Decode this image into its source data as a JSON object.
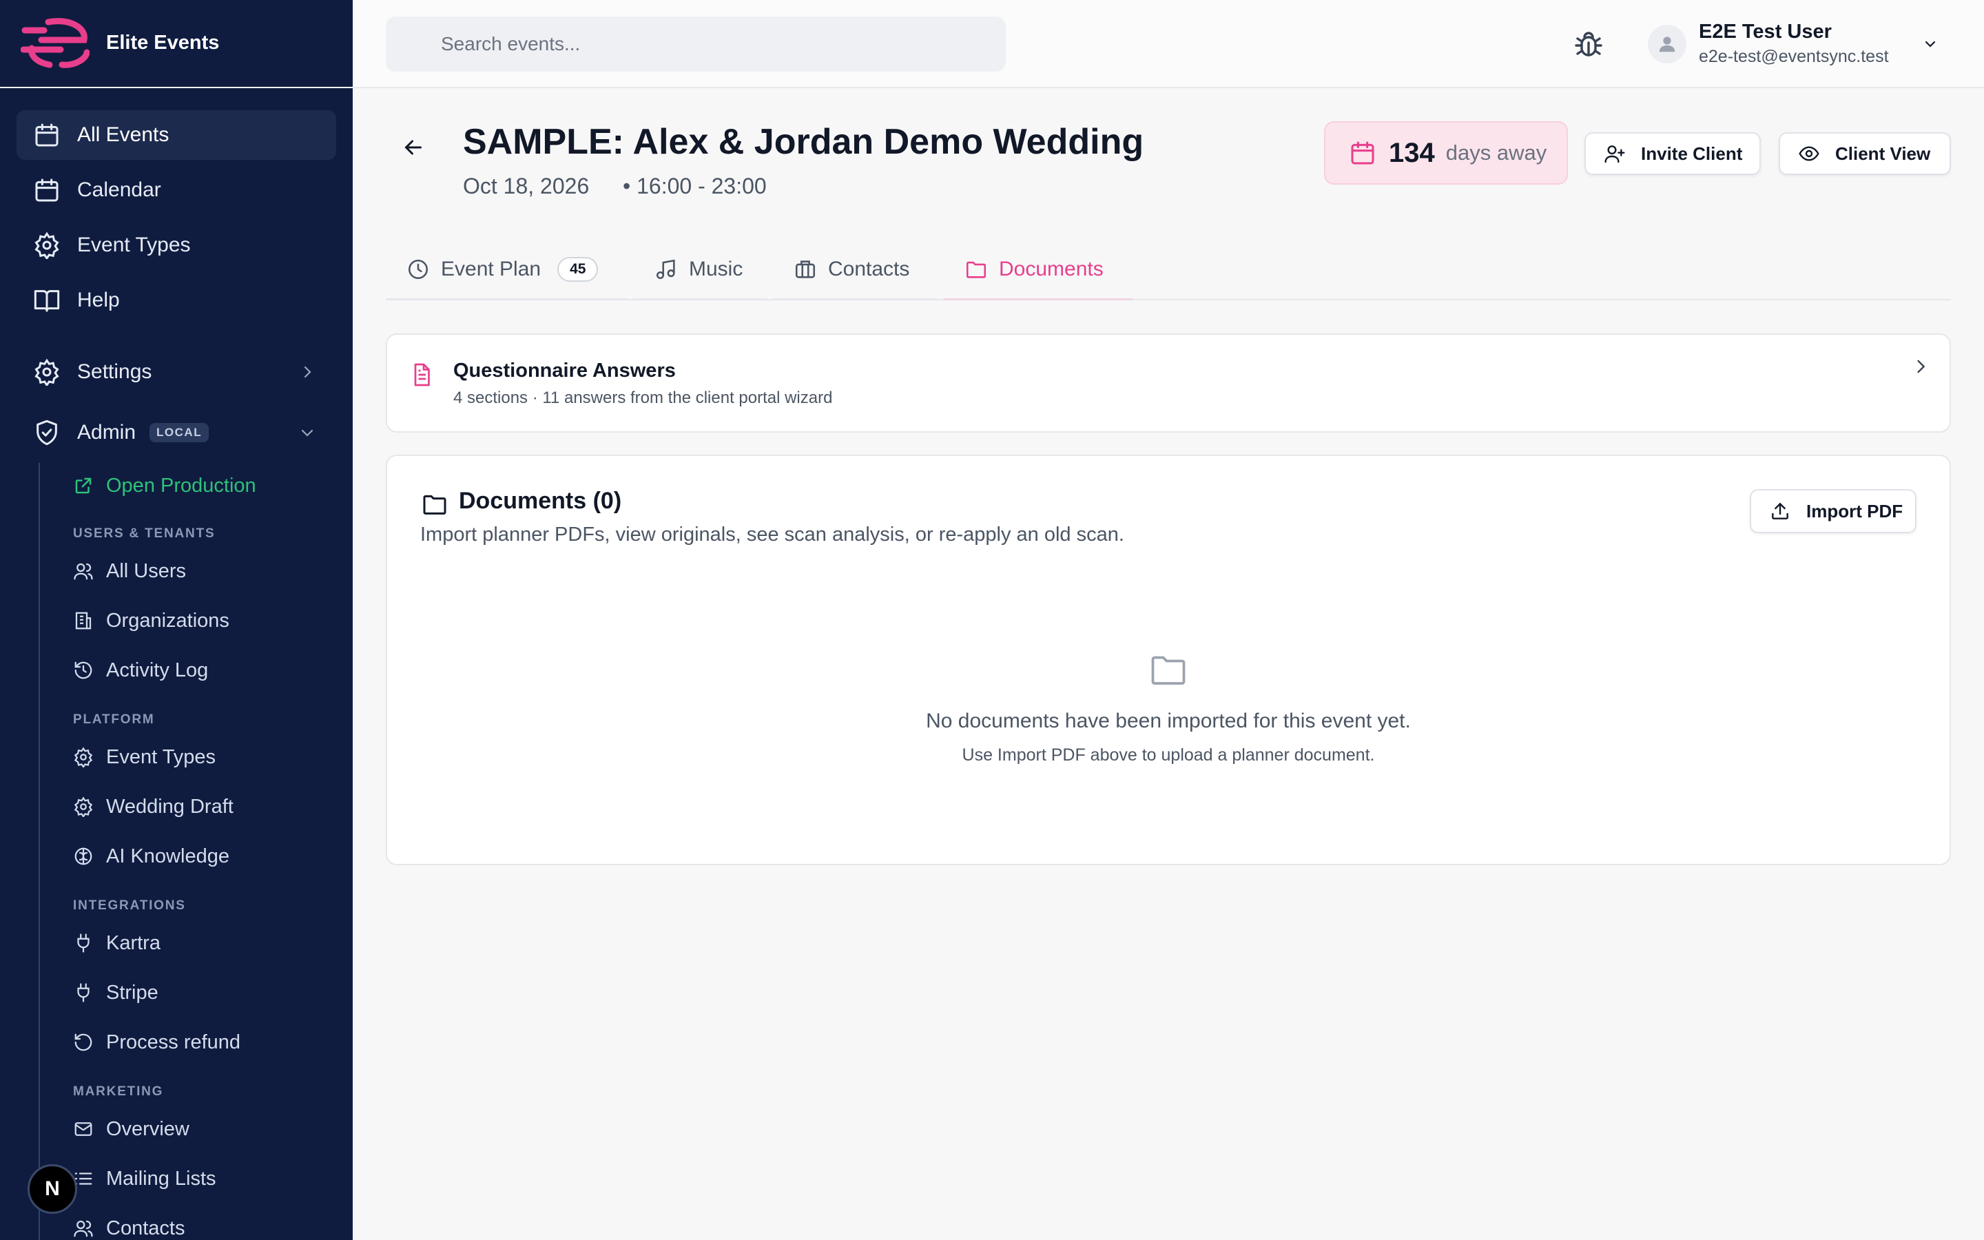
{
  "brand": {
    "name": "Elite Events",
    "accent": "#e83e8c"
  },
  "sidebar": {
    "items": [
      {
        "label": "All Events",
        "icon": "calendar-icon",
        "active": true
      },
      {
        "label": "Calendar",
        "icon": "calendar-icon"
      },
      {
        "label": "Event Types",
        "icon": "gear-icon"
      },
      {
        "label": "Help",
        "icon": "book-icon"
      }
    ],
    "settings": {
      "label": "Settings",
      "icon": "gear-icon"
    },
    "admin": {
      "label": "Admin",
      "badge": "LOCAL",
      "icon": "shield-icon"
    },
    "open_production": "Open Production",
    "sections": [
      {
        "title": "USERS & TENANTS",
        "items": [
          "All Users",
          "Organizations",
          "Activity Log"
        ]
      },
      {
        "title": "PLATFORM",
        "items": [
          "Event Types",
          "Wedding Draft",
          "AI Knowledge"
        ]
      },
      {
        "title": "INTEGRATIONS",
        "items": [
          "Kartra",
          "Stripe",
          "Process refund"
        ]
      },
      {
        "title": "MARKETING",
        "items": [
          "Overview",
          "Mailing Lists",
          "Contacts"
        ]
      }
    ],
    "dev_badge": "N"
  },
  "topbar": {
    "search_placeholder": "Search events...",
    "user": {
      "name": "E2E Test User",
      "email": "e2e-test@eventsync.test"
    }
  },
  "event": {
    "title": "SAMPLE: Alex & Jordan Demo Wedding",
    "date": "Oct 18, 2026",
    "time": "• 16:00 - 23:00",
    "days_number": "134",
    "days_label": "days away",
    "invite_label": "Invite Client",
    "client_view_label": "Client View"
  },
  "tabs": [
    {
      "label": "Event Plan",
      "count": "45",
      "icon": "clock-icon"
    },
    {
      "label": "Music",
      "icon": "music-icon"
    },
    {
      "label": "Contacts",
      "icon": "briefcase-icon"
    },
    {
      "label": "Documents",
      "icon": "folder-icon",
      "active": true
    }
  ],
  "questionnaire": {
    "title": "Questionnaire Answers",
    "subtitle": "4 sections · 11 answers from the client portal wizard"
  },
  "documents": {
    "title": "Documents (0)",
    "subtitle": "Import planner PDFs, view originals, see scan analysis, or re-apply an old scan.",
    "import_label": "Import PDF",
    "empty_title": "No documents have been imported for this event yet.",
    "empty_hint": "Use Import PDF above to upload a planner document."
  }
}
